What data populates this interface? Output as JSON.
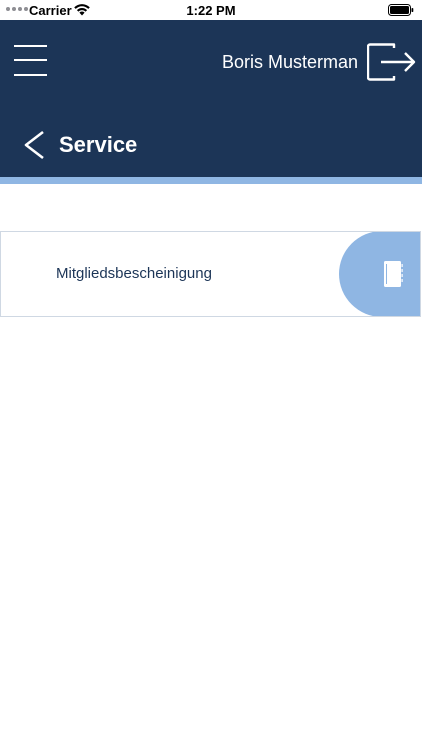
{
  "status_bar": {
    "carrier": "Carrier",
    "time": "1:22 PM",
    "icons": [
      "signal-dots",
      "wifi-icon",
      "battery-icon"
    ]
  },
  "header": {
    "user_name": "Boris Musterman",
    "title": "Service",
    "icons": [
      "hamburger-menu-icon",
      "logout-icon",
      "back-chevron-icon"
    ],
    "colors": {
      "background": "#1c3557",
      "accent": "#8fb6e3"
    }
  },
  "services": [
    {
      "label": "Mitgliedsbescheinigung",
      "icon": "document-icon"
    }
  ]
}
